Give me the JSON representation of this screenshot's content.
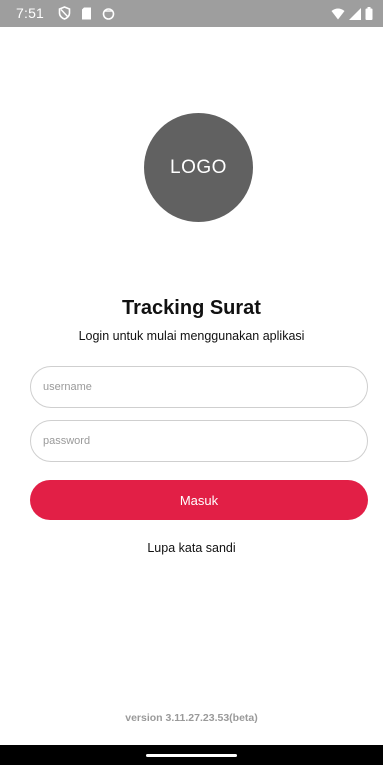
{
  "status_bar": {
    "time": "7:51",
    "left_icons": [
      "shield-icon",
      "sd-card-icon",
      "sync-icon"
    ],
    "right_icons": [
      "wifi-icon",
      "signal-icon",
      "battery-icon"
    ]
  },
  "logo": {
    "text": "LOGO"
  },
  "header": {
    "title": "Tracking Surat",
    "subtitle": "Login untuk mulai menggunakan aplikasi"
  },
  "form": {
    "username": {
      "value": "",
      "placeholder": "username"
    },
    "password": {
      "value": "",
      "placeholder": "password"
    },
    "submit_label": "Masuk",
    "forgot_label": "Lupa kata sandi"
  },
  "footer": {
    "version": "version 3.11.27.23.53(beta)"
  },
  "colors": {
    "accent": "#e21f46",
    "status_bar": "#9e9e9e",
    "logo_circle": "#616161"
  }
}
